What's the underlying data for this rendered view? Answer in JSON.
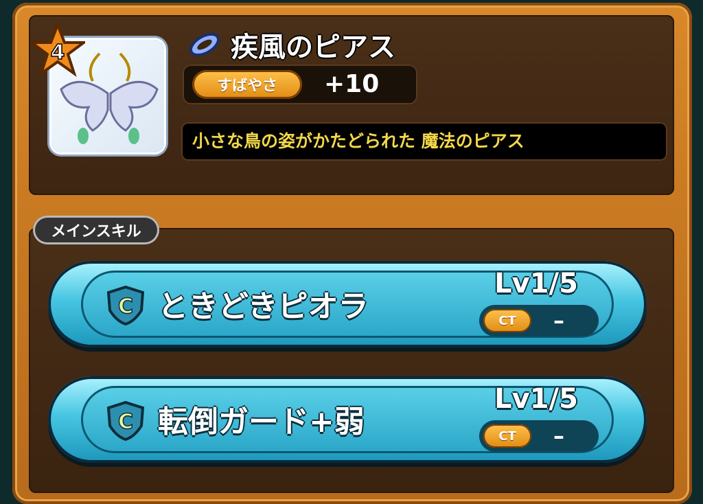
{
  "item": {
    "rarity": "4",
    "title": "疾風のピアス",
    "stat_label": "すばやさ",
    "stat_value": "+10",
    "description": "小さな鳥の姿がかたどられた 魔法のピアス",
    "icon": "earring-icon"
  },
  "section": {
    "main_skill_label": "メインスキル"
  },
  "skills": [
    {
      "rank": "C",
      "name": "ときどきピオラ",
      "level": "Lv1/5",
      "ct_label": "CT",
      "ct_value": "–"
    },
    {
      "rank": "C",
      "name": "転倒ガード+弱",
      "level": "Lv1/5",
      "ct_label": "CT",
      "ct_value": "–"
    }
  ],
  "colors": {
    "accent": "#e08b12",
    "skill_bar": "#47c6e2",
    "desc_text": "#f3d84a"
  }
}
